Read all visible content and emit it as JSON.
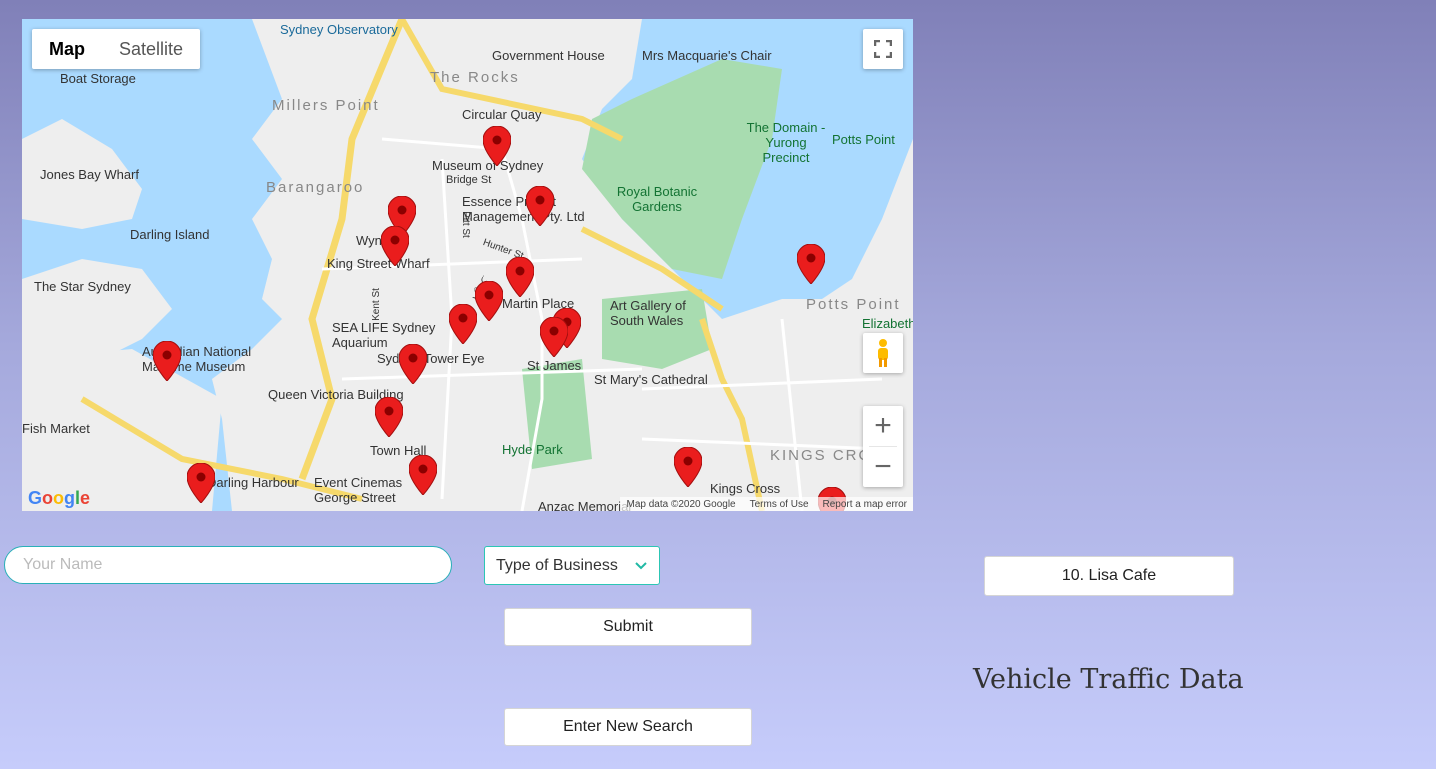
{
  "map": {
    "map_type_options": [
      "Map",
      "Satellite"
    ],
    "active_map_type": "Map",
    "zoom_in_label": "+",
    "zoom_out_label": "−",
    "labels": [
      "Sydney Observatory",
      "Government House",
      "Mrs Macquarie's Chair",
      "The Rocks",
      "Millers Point",
      "Boat Storage",
      "Circular Quay",
      "The Domain - Yurong Precinct",
      "Potts Point",
      "Museum of Sydney",
      "Jones Bay Wharf",
      "Barangaroo",
      "Bridge St",
      "Essence Project Management Pty. Ltd",
      "Royal Botanic Gardens",
      "Darling Island",
      "Wynyard",
      "King Street Wharf",
      "The Star Sydney",
      "Art Gallery of South Wales",
      "Potts Point",
      "Elizabeth Bay",
      "SEA LIFE Sydney Aquarium",
      "Sydney Tower Eye",
      "St James",
      "Australian National Maritime Museum",
      "St Mary's Cathedral",
      "Queen Victoria Building",
      "Fish Market",
      "Town Hall",
      "Hyde Park",
      "KINGS CROSS",
      "Darling Harbour",
      "Event Cinemas George Street",
      "Kings Cross",
      "Anzac Memorial",
      "Martin Place",
      "Hunter St",
      "Kent St",
      "Pitt St"
    ],
    "attribution": "Map data ©2020 Google",
    "terms": "Terms of Use",
    "report": "Report a map error",
    "logo": "Google"
  },
  "form": {
    "name_placeholder": "Your Name",
    "name_value": "",
    "business_select_label": "Type of Business",
    "submit_label": "Submit",
    "new_search_label": "Enter New Search"
  },
  "result": {
    "cafe_label": "10. Lisa Cafe"
  },
  "heading": "Vehicle Traffic Data",
  "colors": {
    "pin": "#ea1d1d",
    "accent": "#2cc6b4",
    "water": "#aadaff",
    "park": "#a8dcb0"
  }
}
